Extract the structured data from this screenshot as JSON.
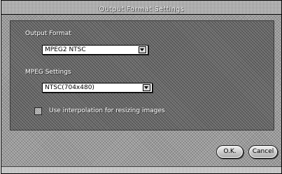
{
  "dialog": {
    "title": "Output Format Settings"
  },
  "output_format": {
    "label": "Output Format",
    "selected": "MPEG2 NTSC"
  },
  "mpeg_settings": {
    "label": "MPEG Settings",
    "selected": "NTSC(704x480)"
  },
  "interpolation": {
    "label": "Use interpolation for resizing images",
    "checked": false
  },
  "buttons": {
    "ok_label": "O.K.",
    "cancel_label": "Cancel"
  }
}
